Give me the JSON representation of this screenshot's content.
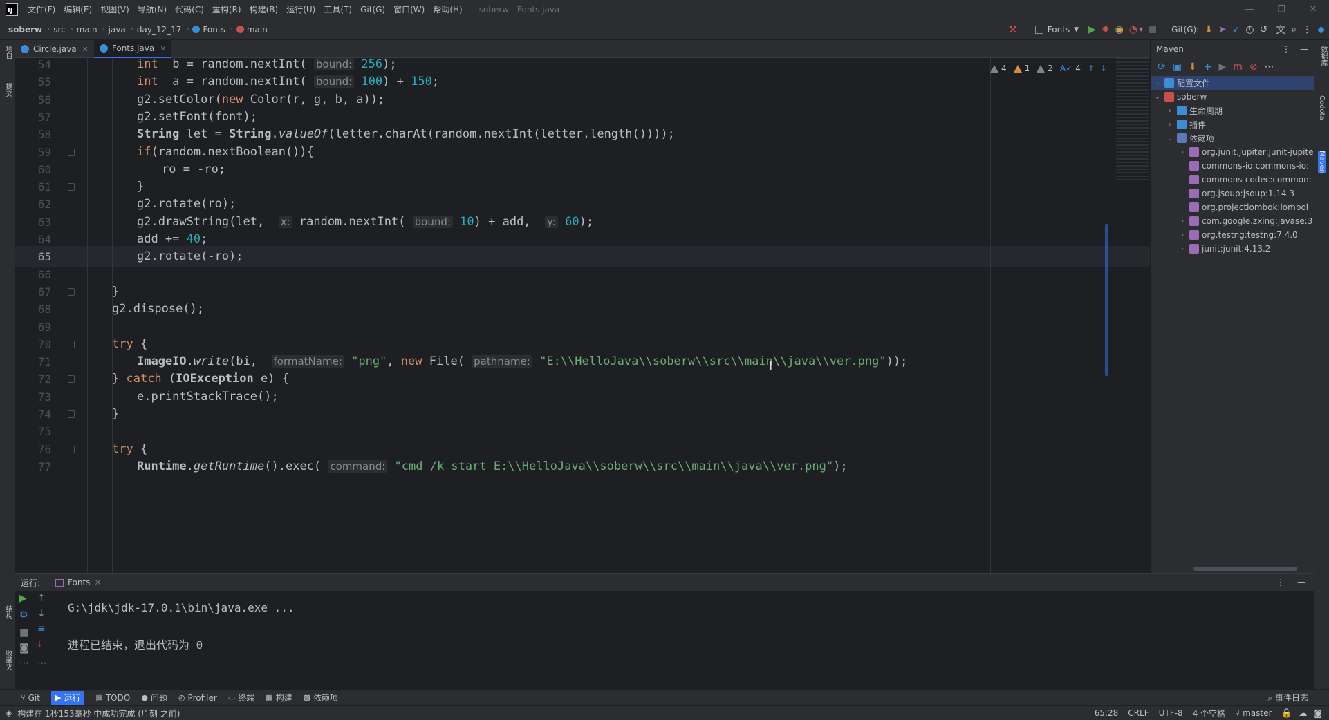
{
  "titlebar": {
    "menus": [
      "文件(F)",
      "编辑(E)",
      "视图(V)",
      "导航(N)",
      "代码(C)",
      "重构(R)",
      "构建(B)",
      "运行(U)",
      "工具(T)",
      "Git(G)",
      "窗口(W)",
      "帮助(H)"
    ],
    "window_title": "soberw - Fonts.java",
    "min": "—",
    "max": "❐",
    "close": "✕"
  },
  "navbar": {
    "crumbs": [
      "soberw",
      "src",
      "main",
      "java",
      "day_12_17",
      "Fonts",
      "main"
    ],
    "run_config": "Fonts",
    "git_label": "Git(G):"
  },
  "tabs": [
    {
      "label": "Circle.java",
      "active": false
    },
    {
      "label": "Fonts.java",
      "active": true
    }
  ],
  "inspection": {
    "warn_a": "4",
    "warn_b": "1",
    "weak": "2",
    "typo": "4"
  },
  "editor": {
    "current_line": 65,
    "lines": [
      {
        "n": "54",
        "indent": 3
      },
      {
        "n": "55",
        "indent": 3
      },
      {
        "n": "56",
        "indent": 3
      },
      {
        "n": "57",
        "indent": 3
      },
      {
        "n": "58",
        "indent": 3
      },
      {
        "n": "59",
        "indent": 3
      },
      {
        "n": "60",
        "indent": 4
      },
      {
        "n": "61",
        "indent": 3
      },
      {
        "n": "62",
        "indent": 3
      },
      {
        "n": "63",
        "indent": 3
      },
      {
        "n": "64",
        "indent": 3
      },
      {
        "n": "65",
        "indent": 3
      },
      {
        "n": "66",
        "indent": 0
      },
      {
        "n": "67",
        "indent": 2
      },
      {
        "n": "68",
        "indent": 2
      },
      {
        "n": "69",
        "indent": 0
      },
      {
        "n": "70",
        "indent": 2
      },
      {
        "n": "71",
        "indent": 3
      },
      {
        "n": "72",
        "indent": 2
      },
      {
        "n": "73",
        "indent": 3
      },
      {
        "n": "74",
        "indent": 2
      },
      {
        "n": "75",
        "indent": 0
      },
      {
        "n": "76",
        "indent": 2
      },
      {
        "n": "77",
        "indent": 3
      }
    ],
    "code": {
      "l54": [
        [
          "kw",
          "int"
        ],
        [
          "",
          "  b = random.nextInt( "
        ],
        [
          "hint",
          "bound:"
        ],
        [
          "num",
          " 256"
        ],
        [
          "",
          ");"
        ]
      ],
      "l55": [
        [
          "kw",
          "int"
        ],
        [
          "",
          "  a = random.nextInt( "
        ],
        [
          "hint",
          "bound:"
        ],
        [
          "num",
          " 100"
        ],
        [
          "",
          ") + "
        ],
        [
          "num",
          "150"
        ],
        [
          "",
          ";"
        ]
      ],
      "l56": [
        [
          "",
          "g2.setColor("
        ],
        [
          "kw",
          "new "
        ],
        [
          "",
          "Color(r, g, b, a));"
        ]
      ],
      "l57": [
        [
          "",
          "g2.setFont(font);"
        ]
      ],
      "l58": [
        [
          "typ",
          "String"
        ],
        [
          "",
          " let = "
        ],
        [
          "typ",
          "String"
        ],
        [
          "",
          "."
        ],
        [
          "ital",
          "valueOf"
        ],
        [
          "",
          "(letter.charAt(random.nextInt(letter.length())));"
        ]
      ],
      "l59": [
        [
          "kw",
          "if"
        ],
        [
          "",
          "(random.nextBoolean()){"
        ]
      ],
      "l60": [
        [
          "",
          "ro = -ro;"
        ]
      ],
      "l61": [
        [
          "",
          "}"
        ]
      ],
      "l62": [
        [
          "",
          "g2.rotate(ro);"
        ]
      ],
      "l63": [
        [
          "",
          "g2.drawString(let,  "
        ],
        [
          "hint",
          "x:"
        ],
        [
          "",
          " random.nextInt( "
        ],
        [
          "hint",
          "bound:"
        ],
        [
          "num",
          " 10"
        ],
        [
          "",
          ") + add,  "
        ],
        [
          "hint",
          "y:"
        ],
        [
          "num",
          " 60"
        ],
        [
          "",
          ");"
        ]
      ],
      "l64": [
        [
          "",
          "add += "
        ],
        [
          "num",
          "40"
        ],
        [
          "",
          ";"
        ]
      ],
      "l65": [
        [
          "",
          "g2.rotate(-ro);"
        ]
      ],
      "l66": [],
      "l67": [
        [
          "",
          "}"
        ]
      ],
      "l68": [
        [
          "",
          "g2.dispose();"
        ]
      ],
      "l69": [],
      "l70": [
        [
          "kw",
          "try"
        ],
        [
          "",
          " {"
        ]
      ],
      "l71": [
        [
          "typ",
          "ImageIO"
        ],
        [
          "",
          "."
        ],
        [
          "ital",
          "write"
        ],
        [
          "",
          "(bi,  "
        ],
        [
          "hint",
          "formatName:"
        ],
        [
          "str",
          " \"png\""
        ],
        [
          "",
          ", "
        ],
        [
          "kw",
          "new "
        ],
        [
          "",
          "File( "
        ],
        [
          "hint",
          "pathname:"
        ],
        [
          "str",
          " \"E:\\\\HelloJava\\\\soberw\\\\src\\\\main\\\\java\\\\ver.png\""
        ],
        [
          "",
          "));"
        ]
      ],
      "l72": [
        [
          "",
          "} "
        ],
        [
          "kw",
          "catch"
        ],
        [
          "",
          " ("
        ],
        [
          "typ",
          "IOException"
        ],
        [
          "",
          " e) {"
        ]
      ],
      "l73": [
        [
          "",
          "e.printStackTrace();"
        ]
      ],
      "l74": [
        [
          "",
          "}"
        ]
      ],
      "l75": [],
      "l76": [
        [
          "kw",
          "try"
        ],
        [
          "",
          " {"
        ]
      ],
      "l77": [
        [
          "typ",
          "Runtime"
        ],
        [
          "",
          "."
        ],
        [
          "ital",
          "getRuntime"
        ],
        [
          "",
          "().exec( "
        ],
        [
          "hint",
          "command:"
        ],
        [
          "str",
          " \"cmd /k start E:\\\\HelloJava\\\\soberw\\\\src\\\\main\\\\java\\\\ver.png\""
        ],
        [
          "",
          ");"
        ]
      ]
    }
  },
  "maven": {
    "title": "Maven",
    "tree": [
      {
        "label": "配置文件",
        "depth": 0,
        "arrow": "›",
        "icon": "folder-icon",
        "color": "#3b8ed6",
        "selected": true
      },
      {
        "label": "soberw",
        "depth": 0,
        "arrow": "⌄",
        "icon": "maven-project-icon",
        "color": "#c94f4f"
      },
      {
        "label": "生命周期",
        "depth": 1,
        "arrow": "›",
        "icon": "lifecycle-folder-icon",
        "color": "#3b8ed6"
      },
      {
        "label": "插件",
        "depth": 1,
        "arrow": "›",
        "icon": "plugins-folder-icon",
        "color": "#3b8ed6"
      },
      {
        "label": "依赖项",
        "depth": 1,
        "arrow": "⌄",
        "icon": "dependencies-folder-icon",
        "color": "#5a7ab8"
      },
      {
        "label": "org.junit.jupiter:junit-jupite",
        "depth": 2,
        "arrow": "›",
        "icon": "library-icon",
        "color": "#9b6bb8"
      },
      {
        "label": "commons-io:commons-io:",
        "depth": 2,
        "arrow": "",
        "icon": "library-icon",
        "color": "#9b6bb8"
      },
      {
        "label": "commons-codec:common:",
        "depth": 2,
        "arrow": "",
        "icon": "library-icon",
        "color": "#9b6bb8"
      },
      {
        "label": "org.jsoup:jsoup:1.14.3",
        "depth": 2,
        "arrow": "",
        "icon": "library-icon",
        "color": "#9b6bb8"
      },
      {
        "label": "org.projectlombok:lombol",
        "depth": 2,
        "arrow": "",
        "icon": "library-icon",
        "color": "#9b6bb8"
      },
      {
        "label": "com.google.zxing:javase:3",
        "depth": 2,
        "arrow": "›",
        "icon": "library-icon",
        "color": "#9b6bb8"
      },
      {
        "label": "org.testng:testng:7.4.0",
        "depth": 2,
        "arrow": "›",
        "icon": "library-icon",
        "color": "#9b6bb8"
      },
      {
        "label": "junit:junit:4.13.2",
        "depth": 2,
        "arrow": "›",
        "icon": "library-icon",
        "color": "#9b6bb8"
      }
    ]
  },
  "run": {
    "label": "运行:",
    "tab": "Fonts",
    "output": [
      "G:\\jdk\\jdk-17.0.1\\bin\\java.exe ...",
      "",
      "进程已结束，退出代码为 0"
    ]
  },
  "left_strip": {
    "project": "项目",
    "commit": "提交",
    "structure": "结构",
    "favorites": "收藏夹"
  },
  "right_strip": {
    "database": "数据库",
    "codota": "Codota",
    "maven": "Maven"
  },
  "toolwindows": [
    {
      "label": "Git",
      "icon": "git-icon",
      "active": false
    },
    {
      "label": "运行",
      "icon": "run-icon",
      "active": true
    },
    {
      "label": "TODO",
      "icon": "todo-icon",
      "active": false
    },
    {
      "label": "问题",
      "icon": "problems-icon",
      "active": false
    },
    {
      "label": "Profiler",
      "icon": "profiler-icon",
      "active": false
    },
    {
      "label": "终端",
      "icon": "terminal-icon",
      "active": false
    },
    {
      "label": "构建",
      "icon": "build-icon",
      "active": false
    },
    {
      "label": "依赖项",
      "icon": "dependencies-icon",
      "active": false
    }
  ],
  "event_log": "事件日志",
  "status": {
    "message": "构建在 1秒153毫秒 中成功完成 (片刻 之前)",
    "position": "65:28",
    "line_sep": "CRLF",
    "encoding": "UTF-8",
    "indent": "4 个空格",
    "branch": "master"
  },
  "colors": {
    "accent": "#3574f0",
    "background": "#1e1f22",
    "panel": "#2b2d30"
  }
}
